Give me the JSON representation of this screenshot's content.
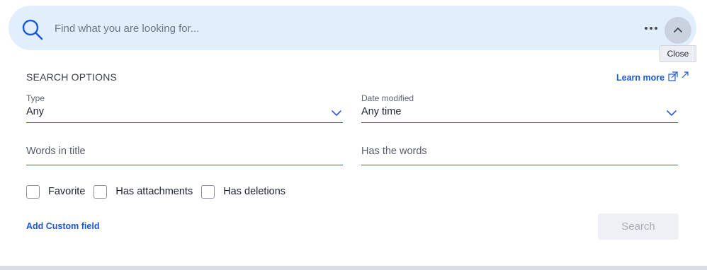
{
  "search": {
    "placeholder": "Find what you are looking for...",
    "collapse_tooltip": "Close"
  },
  "options": {
    "title": "SEARCH OPTIONS",
    "learn_more": "Learn more",
    "type": {
      "label": "Type",
      "value": "Any"
    },
    "date_modified": {
      "label": "Date modified",
      "value": "Any time"
    },
    "words_in_title": {
      "placeholder": "Words in title"
    },
    "has_the_words": {
      "placeholder": "Has the words"
    },
    "checkboxes": [
      {
        "label": "Favorite",
        "checked": false
      },
      {
        "label": "Has attachments",
        "checked": false
      },
      {
        "label": "Has deletions",
        "checked": false
      }
    ],
    "add_custom_field": "Add Custom field",
    "search_button": "Search"
  },
  "icons": {
    "search": "search-icon",
    "more": "more-horizontal-icon",
    "collapse": "chevron-up-icon",
    "external_link": "external-link-icon",
    "dropdown": "chevron-down-icon"
  },
  "colors": {
    "search_bar_bg": "#e1eefb",
    "accent": "#1a56d6",
    "underline": "#2f5bd8",
    "disabled_button_bg": "#eef0f3",
    "disabled_button_text": "#a7adb7"
  }
}
